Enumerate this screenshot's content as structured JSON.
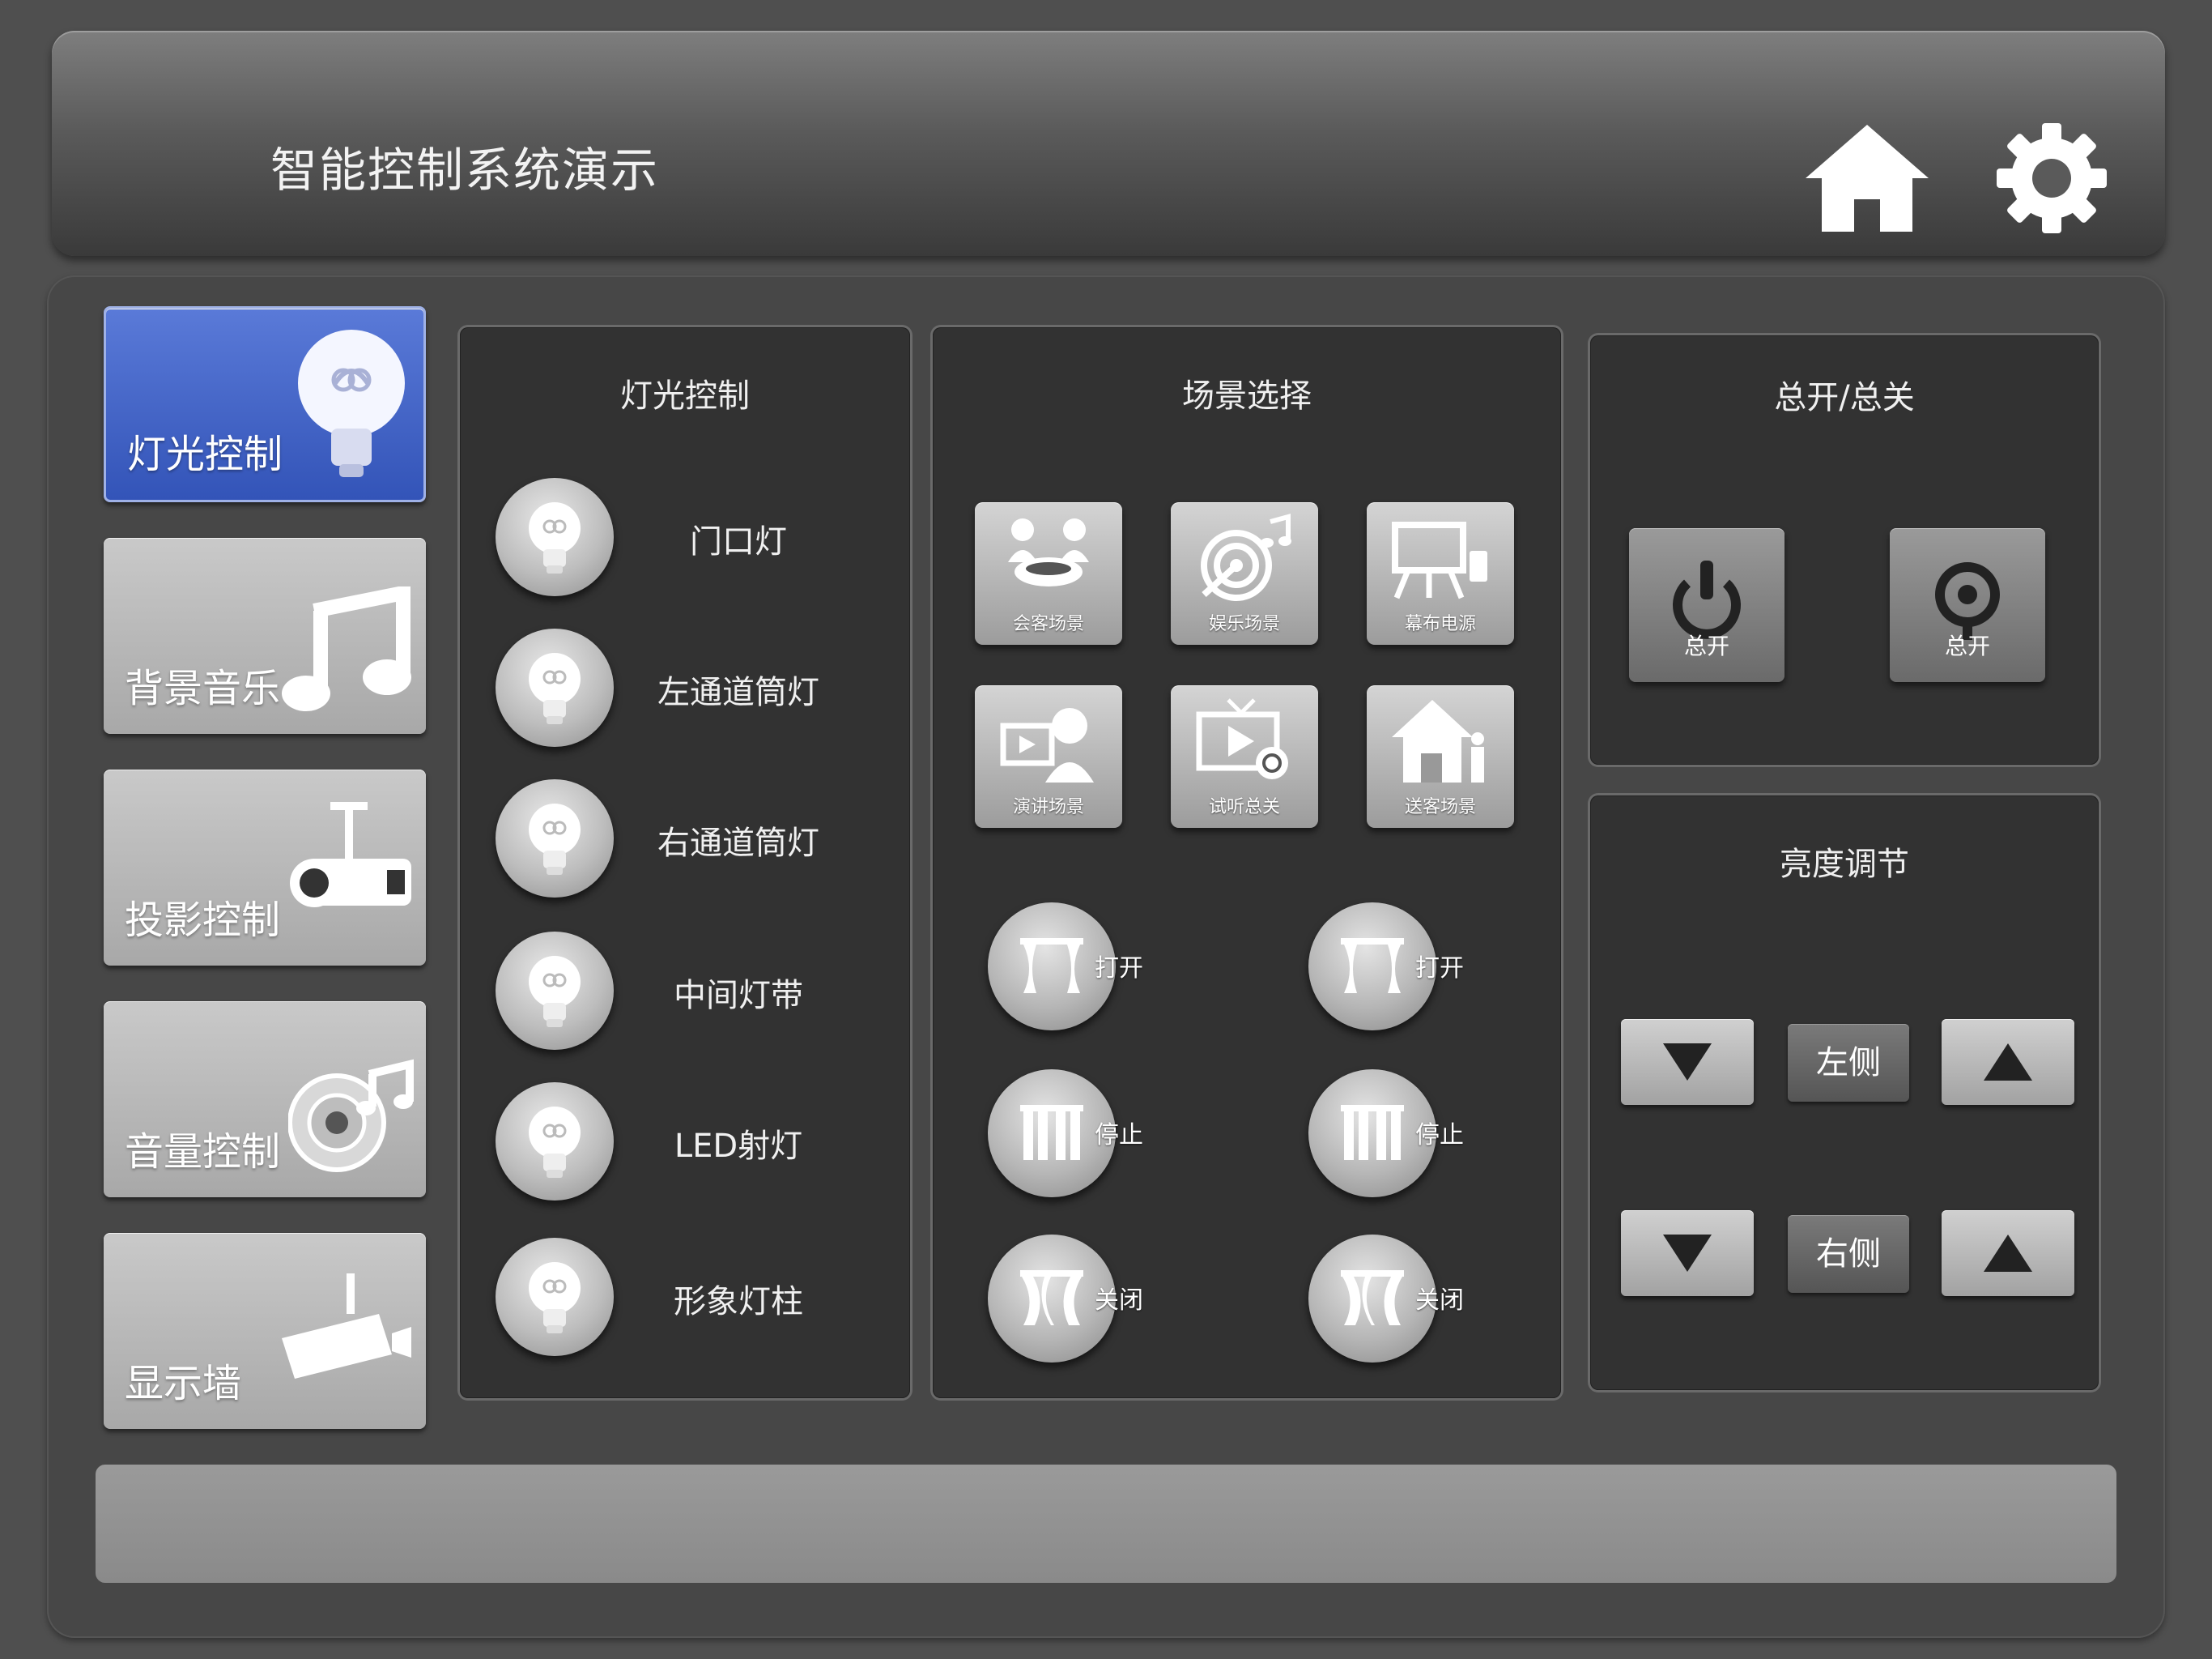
{
  "header": {
    "title": "智能控制系统演示"
  },
  "icons": {
    "home": "home-icon",
    "settings": "gear-icon"
  },
  "colors": {
    "active_blue": "#3f61c6",
    "background": "#4f4f4f",
    "panel": "#323232"
  },
  "sidebar": {
    "items": [
      {
        "label": "灯光控制",
        "icon": "bulb-icon",
        "active": true
      },
      {
        "label": "背景音乐",
        "icon": "music-note-icon",
        "active": false
      },
      {
        "label": "投影控制",
        "icon": "projector-icon",
        "active": false
      },
      {
        "label": "音量控制",
        "icon": "speaker-icon",
        "active": false
      },
      {
        "label": "显示墙",
        "icon": "camera-icon",
        "active": false
      }
    ]
  },
  "lights": {
    "title": "灯光控制",
    "items": [
      "门口灯",
      "左通道筒灯",
      "右通道筒灯",
      "中间灯带",
      "LED射灯",
      "形象灯柱"
    ]
  },
  "scenes": {
    "title": "场景选择",
    "items": [
      "会客场景",
      "娱乐场景",
      "幕布电源",
      "演讲场景",
      "试听总关",
      "送客场景"
    ],
    "curtain_left": [
      "打开",
      "停止",
      "关闭"
    ],
    "curtain_right": [
      "打开",
      "停止",
      "关闭"
    ]
  },
  "power": {
    "title": "总开/总关",
    "buttons": [
      "总开",
      "总开"
    ]
  },
  "brightness": {
    "title": "亮度调节",
    "left_label": "左侧",
    "right_label": "右侧"
  }
}
